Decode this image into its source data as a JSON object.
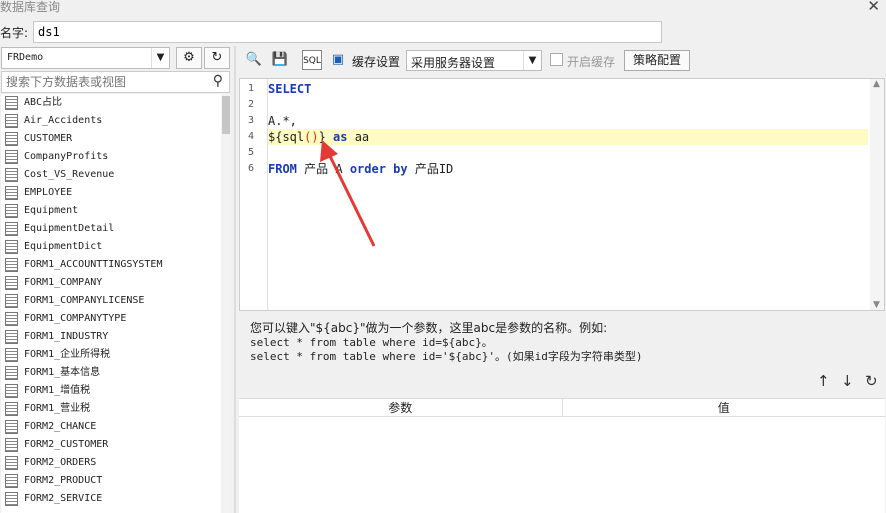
{
  "window": {
    "title": "数据库查询",
    "close": "✕"
  },
  "name_row": {
    "label": "名字:",
    "value": "ds1"
  },
  "left": {
    "datasource": "FRDemo",
    "search_placeholder": "搜索下方数据表或视图",
    "tables": [
      "ABC占比",
      "Air_Accidents",
      "CUSTOMER",
      "CompanyProfits",
      "Cost_VS_Revenue",
      "EMPLOYEE",
      "Equipment",
      "EquipmentDetail",
      "EquipmentDict",
      "FORM1_ACCOUNTTINGSYSTEM",
      "FORM1_COMPANY",
      "FORM1_COMPANYLICENSE",
      "FORM1_COMPANYTYPE",
      "FORM1_INDUSTRY",
      "FORM1_企业所得税",
      "FORM1_基本信息",
      "FORM1_增值税",
      "FORM1_营业税",
      "FORM2_CHANCE",
      "FORM2_CUSTOMER",
      "FORM2_ORDERS",
      "FORM2_PRODUCT",
      "FORM2_SERVICE"
    ]
  },
  "toolbar": {
    "cache_label": "缓存设置",
    "cache_value": "采用服务器设置",
    "enable_cache_label": "开启缓存",
    "strategy_button": "策略配置",
    "sql_icon_text": "SQL"
  },
  "editor": {
    "line_numbers": [
      "1",
      "2",
      "3",
      "4",
      "5",
      "6"
    ]
  },
  "help": {
    "line1": "您可以键入\"${abc}\"做为一个参数，这里abc是参数的名称。例如:",
    "line2": "select * from table where id=${abc}。",
    "line3": "select * from table where id='${abc}'。(如果id字段为字符串类型)"
  },
  "params": {
    "col_param": "参数",
    "col_value": "值"
  }
}
